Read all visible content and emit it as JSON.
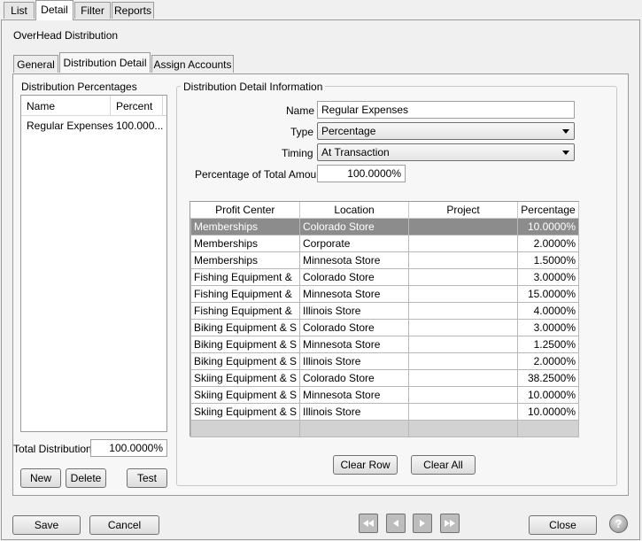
{
  "top_tabs": [
    "List",
    "Detail",
    "Filter",
    "Reports"
  ],
  "heading": "OverHead Distribution",
  "sub_tabs": [
    "General",
    "Distribution Detail",
    "Assign Accounts"
  ],
  "percentages_panel": {
    "title": "Distribution Percentages",
    "columns": [
      "Name",
      "Percent"
    ],
    "rows": [
      {
        "name": "Regular Expenses",
        "percent": "100.000..."
      }
    ],
    "total_label": "Total Distribution",
    "total_value": "100.0000%",
    "buttons": {
      "new": "New",
      "delete": "Delete",
      "test": "Test"
    }
  },
  "detail": {
    "title": "Distribution Detail Information",
    "name_label": "Name",
    "name_value": "Regular Expenses",
    "type_label": "Type",
    "type_value": "Percentage",
    "timing_label": "Timing",
    "timing_value": "At Transaction",
    "pct_label": "Percentage of Total Amount",
    "pct_value": "100.0000%",
    "grid": {
      "columns": [
        "Profit Center",
        "Location",
        "Project",
        "Percentage"
      ],
      "rows": [
        [
          "Memberships",
          "Colorado Store",
          "",
          "10.0000%"
        ],
        [
          "Memberships",
          "Corporate",
          "",
          "2.0000%"
        ],
        [
          "Memberships",
          "Minnesota Store",
          "",
          "1.5000%"
        ],
        [
          "Fishing Equipment &",
          "Colorado Store",
          "",
          "3.0000%"
        ],
        [
          "Fishing Equipment &",
          "Minnesota Store",
          "",
          "15.0000%"
        ],
        [
          "Fishing Equipment &",
          "Illinois Store",
          "",
          "4.0000%"
        ],
        [
          "Biking Equipment & S",
          "Colorado Store",
          "",
          "3.0000%"
        ],
        [
          "Biking Equipment & S",
          "Minnesota Store",
          "",
          "1.2500%"
        ],
        [
          "Biking Equipment & S",
          "Illinois Store",
          "",
          "2.0000%"
        ],
        [
          "Skiing Equipment & S",
          "Colorado Store",
          "",
          "38.2500%"
        ],
        [
          "Skiing Equipment & S",
          "Minnesota Store",
          "",
          "10.0000%"
        ],
        [
          "Skiing Equipment & S",
          "Illinois Store",
          "",
          "10.0000%"
        ]
      ]
    },
    "clear_row": "Clear Row",
    "clear_all": "Clear All"
  },
  "footer": {
    "save": "Save",
    "cancel": "Cancel",
    "close": "Close",
    "help": "?"
  }
}
